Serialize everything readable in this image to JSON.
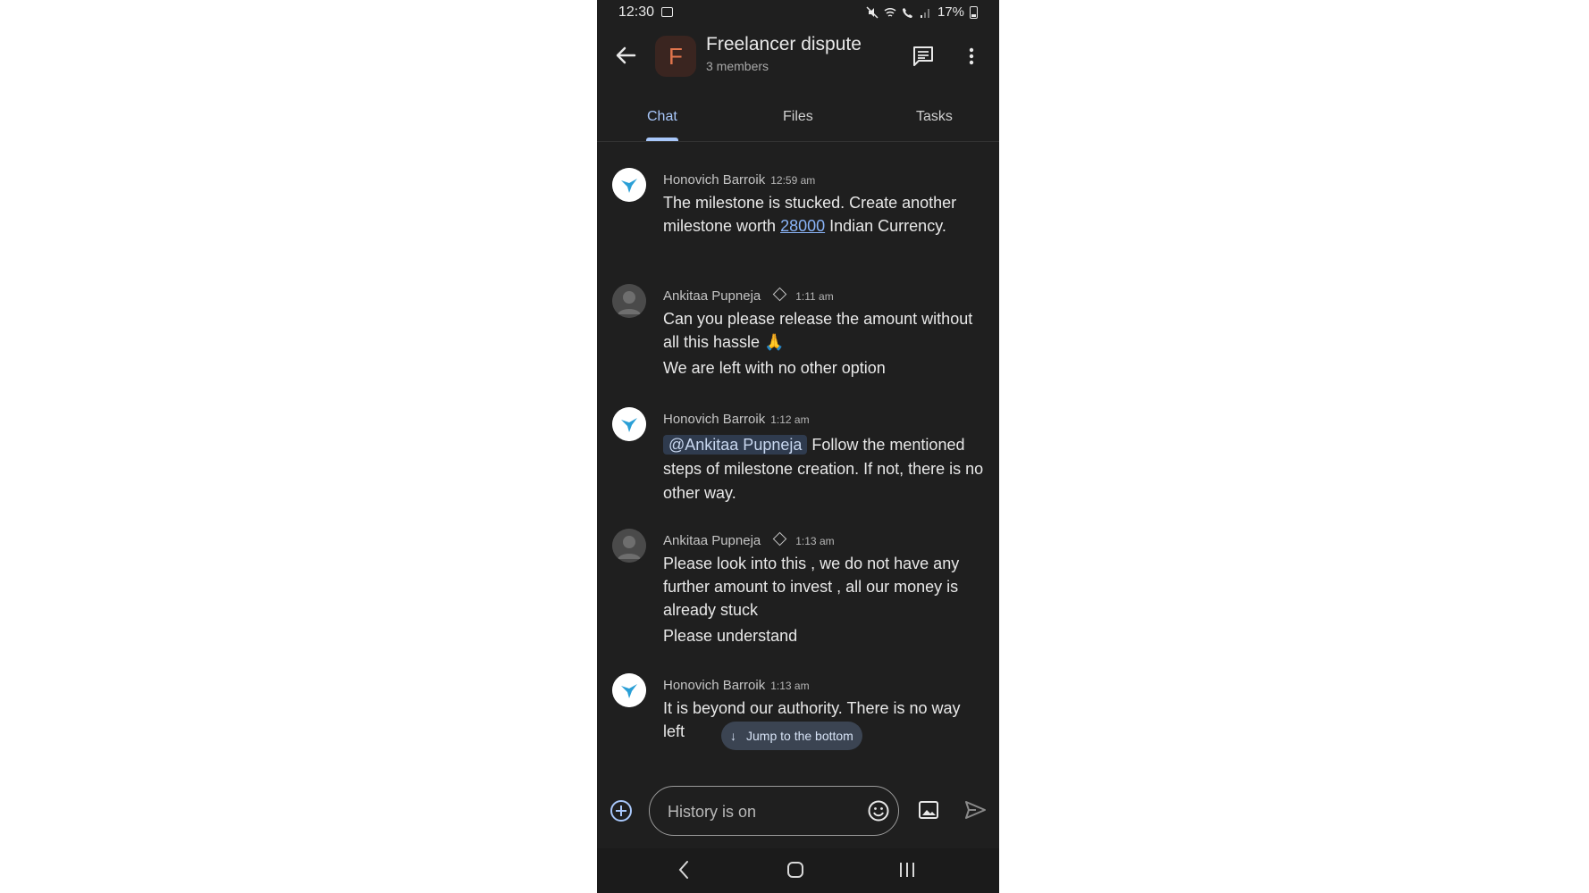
{
  "status_bar": {
    "time": "12:30",
    "battery": "17%"
  },
  "header": {
    "group_initial": "F",
    "title": "Freelancer dispute",
    "subtitle": "3 members"
  },
  "tabs": [
    {
      "label": "Chat",
      "active": true
    },
    {
      "label": "Files",
      "active": false
    },
    {
      "label": "Tasks",
      "active": false
    }
  ],
  "messages": [
    {
      "sender": "Honovich Barroik",
      "time": "12:59 am",
      "verified": false,
      "parts": {
        "before": "The milestone is stucked. Create another milestone worth ",
        "link": "28000",
        "after": " Indian Currency."
      }
    },
    {
      "sender": "Ankitaa Pupneja",
      "time": "1:11 am",
      "verified": true,
      "lines": [
        "Can you please release the amount without all this hassle 🙏",
        "We are left with no other option"
      ]
    },
    {
      "sender": "Honovich Barroik",
      "time": "1:12 am",
      "verified": false,
      "mention": "@Ankitaa Pupneja",
      "text": " Follow the mentioned steps of milestone creation. If not, there is no other way."
    },
    {
      "sender": "Ankitaa Pupneja",
      "time": "1:13 am",
      "verified": true,
      "lines": [
        "Please look into this , we do not have any further amount to invest , all our money is already stuck",
        "Please understand"
      ]
    },
    {
      "sender": "Honovich Barroik",
      "time": "1:13 am",
      "verified": false,
      "text": "It is beyond our authority. There is no way left"
    }
  ],
  "jump_button": "Jump to the bottom",
  "composer": {
    "placeholder": "History is on"
  },
  "colors": {
    "background": "#1f1f1f",
    "accent": "#a8c7fa",
    "link": "#8ab4f8",
    "group_avatar": "#e2754d"
  },
  "icons": [
    "back-arrow-icon",
    "thread-icon",
    "more-vert-icon",
    "add-circle-icon",
    "emoji-icon",
    "image-icon",
    "send-icon",
    "verified-diamond-icon",
    "nav-back-icon",
    "nav-home-icon",
    "nav-recents-icon"
  ]
}
